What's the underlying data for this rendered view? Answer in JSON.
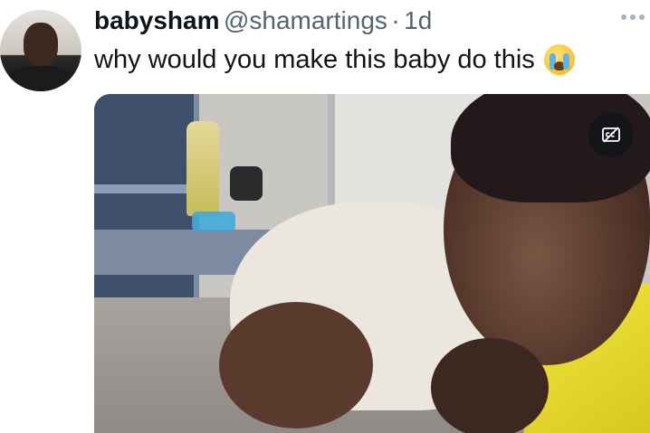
{
  "tweet": {
    "display_name": "babysham",
    "handle": "@shamartings",
    "separator": "·",
    "time": "1d",
    "text": "why would you make this baby do this",
    "emoji": "loudly-crying-face"
  },
  "media": {
    "type": "video",
    "caption_toggle_icon": "closed-captions-off-icon"
  }
}
